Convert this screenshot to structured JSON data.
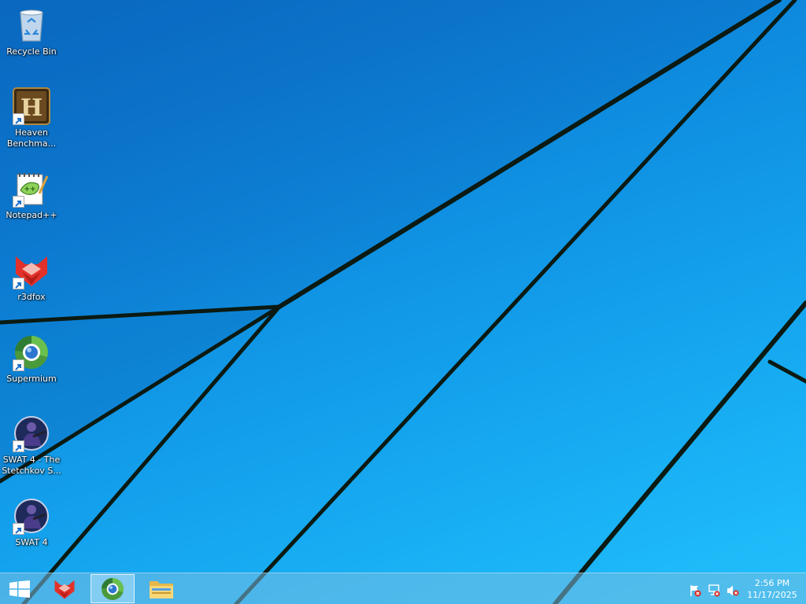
{
  "desktop": {
    "icons": [
      {
        "label": "Recycle Bin",
        "icon": "recycle-bin-icon"
      },
      {
        "label": "Heaven Benchma...",
        "icon": "heaven-benchmark-icon"
      },
      {
        "label": "Notepad++",
        "icon": "notepad-plus-plus-icon"
      },
      {
        "label": "r3dfox",
        "icon": "r3dfox-icon"
      },
      {
        "label": "Supermium",
        "icon": "supermium-icon"
      },
      {
        "label": "SWAT 4 - The Stetchkov S...",
        "icon": "swat4-stetchkov-icon"
      },
      {
        "label": "SWAT 4",
        "icon": "swat4-icon"
      }
    ]
  },
  "taskbar": {
    "start_icon": "windows-start-icon",
    "pinned": [
      {
        "name": "r3dfox",
        "icon": "r3dfox-icon",
        "active": false
      },
      {
        "name": "Supermium",
        "icon": "supermium-icon",
        "active": true
      },
      {
        "name": "File Explorer",
        "icon": "folder-icon",
        "active": false
      }
    ],
    "tray": [
      {
        "icon": "action-center-flag-icon"
      },
      {
        "icon": "network-icon"
      },
      {
        "icon": "volume-muted-icon"
      }
    ],
    "clock": {
      "time": "2:56 PM",
      "date": "11/17/2025"
    }
  },
  "colors": {
    "wallpaper_dark": "#0a6fc8",
    "wallpaper_light": "#22c0fb",
    "wallpaper_lines": "#0b1a12",
    "taskbar": "#78bee1"
  }
}
